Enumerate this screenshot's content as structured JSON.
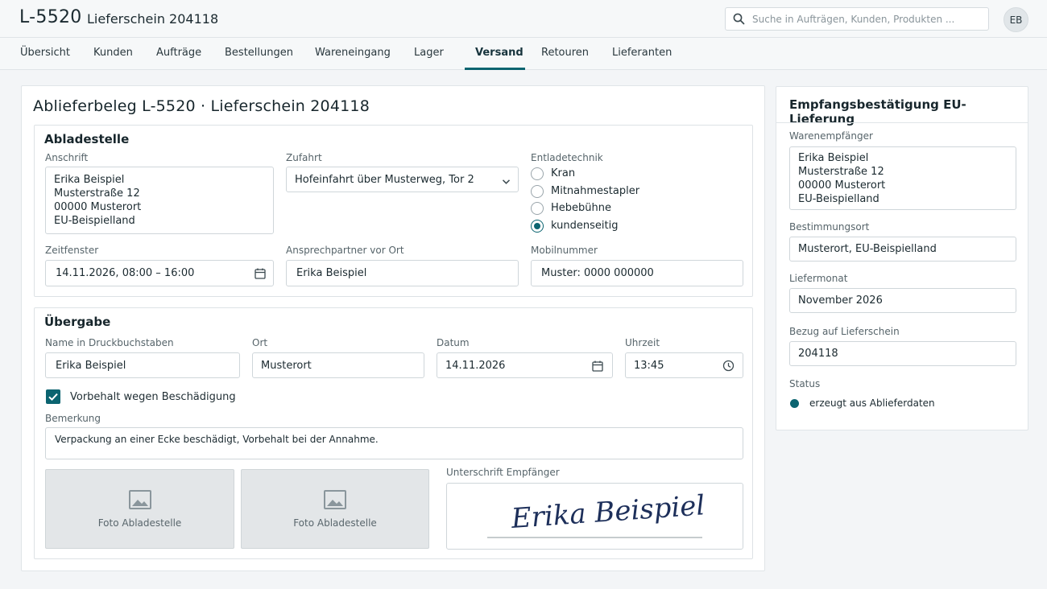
{
  "header": {
    "app_code": "L-5520",
    "separator": "·",
    "subtitle": "Lieferschein 204118",
    "search_placeholder": "Suche in Aufträgen, Kunden, Produkten ...",
    "avatar_initials": "EB"
  },
  "nav": {
    "items": [
      "Übersicht",
      "Kunden",
      "Aufträge",
      "Bestellungen",
      "Wareneingang",
      "Lager",
      "Versand",
      "Retouren",
      "Lieferanten"
    ],
    "active": "Versand"
  },
  "main": {
    "title": "Ablieferbeleg L-5520 · Lieferschein 204118",
    "abladestelle": {
      "heading": "Abladestelle",
      "anschrift_label": "Anschrift",
      "anschrift_lines": [
        "Erika Beispiel",
        "Musterstraße 12",
        "00000 Musterort",
        "EU-Beispielland"
      ],
      "zufahrt_label": "Zufahrt",
      "zufahrt_value": "Hofeinfahrt über Musterweg, Tor 2",
      "entladetechnik_label": "Entladetechnik",
      "entladetechnik_options": [
        "Kran",
        "Mitnahmestapler",
        "Hebebühne",
        "kundenseitig"
      ],
      "entladetechnik_selected": "kundenseitig",
      "zeitfenster_label": "Zeitfenster",
      "zeitfenster_value": "14.11.2026, 08:00 – 16:00",
      "ansprechpartner_label": "Ansprechpartner vor Ort",
      "ansprechpartner_value": "Erika Beispiel",
      "mobil_label": "Mobilnummer",
      "mobil_value": "Muster: 0000 000000"
    },
    "uebergabe": {
      "heading": "Übergabe",
      "name_label": "Name in Druckbuchstaben",
      "name_value": "Erika Beispiel",
      "ort_label": "Ort",
      "ort_value": "Musterort",
      "datum_label": "Datum",
      "datum_value": "14.11.2026",
      "uhrzeit_label": "Uhrzeit",
      "uhrzeit_value": "13:45",
      "vorbehalt_label": "Vorbehalt wegen Beschädigung",
      "vorbehalt_checked": true,
      "bemerkung_label": "Bemerkung",
      "bemerkung_value": "Verpackung an einer Ecke beschädigt, Vorbehalt bei der Annahme.",
      "photo_captions": [
        "Foto Abladestelle",
        "Foto Abladestelle"
      ],
      "unterschrift_label": "Unterschrift Empfänger",
      "signature_text": "Erika Beispiel"
    }
  },
  "side": {
    "title": "Empfangsbestätigung EU-Lieferung",
    "warenempfaenger_label": "Warenempfänger",
    "warenempfaenger_lines": [
      "Erika Beispiel",
      "Musterstraße 12",
      "00000 Musterort",
      "EU-Beispielland"
    ],
    "bestimmungsort_label": "Bestimmungsort",
    "bestimmungsort_value": "Musterort, EU-Beispielland",
    "liefermonat_label": "Liefermonat",
    "liefermonat_value": "November 2026",
    "bezug_label": "Bezug auf Lieferschein",
    "bezug_value": "204118",
    "status_label": "Status",
    "status_value": "erzeugt aus Ablieferdaten"
  },
  "colors": {
    "accent": "#0b6470",
    "background": "#f3f5f7"
  },
  "icons": [
    "search-icon",
    "chevron-down-icon",
    "calendar-icon",
    "clock-icon",
    "image-icon",
    "check-icon"
  ]
}
